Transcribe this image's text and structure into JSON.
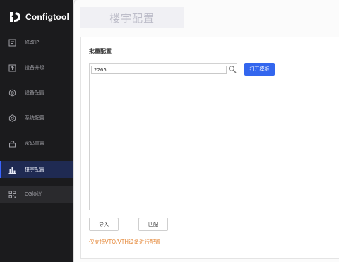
{
  "app": {
    "name": "Configtool",
    "accent_color": "#3366ee",
    "sidebar_bg": "#1b1b1d"
  },
  "sidebar": {
    "items": [
      {
        "label": "修改IP",
        "icon": "edit-icon",
        "active": false
      },
      {
        "label": "设备升级",
        "icon": "upgrade-icon",
        "active": false
      },
      {
        "label": "设备配置",
        "icon": "gear-icon",
        "active": false
      },
      {
        "label": "系统配置",
        "icon": "settings-icon",
        "active": false
      },
      {
        "label": "密码重置",
        "icon": "lock-icon",
        "active": false
      },
      {
        "label": "楼宇配置",
        "icon": "building-chart-icon",
        "active": true
      },
      {
        "label": "CG协议",
        "icon": "qr-code-icon",
        "active": false
      }
    ]
  },
  "page": {
    "title": "楼宇配置"
  },
  "panel": {
    "title": "批量配置",
    "search": {
      "value": "2265",
      "icon": "magnifier-icon"
    },
    "open_template_label": "打开模板",
    "import_label": "导入",
    "match_label": "匹配",
    "note": "仅支持VTO/VTH设备进行配置",
    "note_color": "#e58a3c"
  }
}
